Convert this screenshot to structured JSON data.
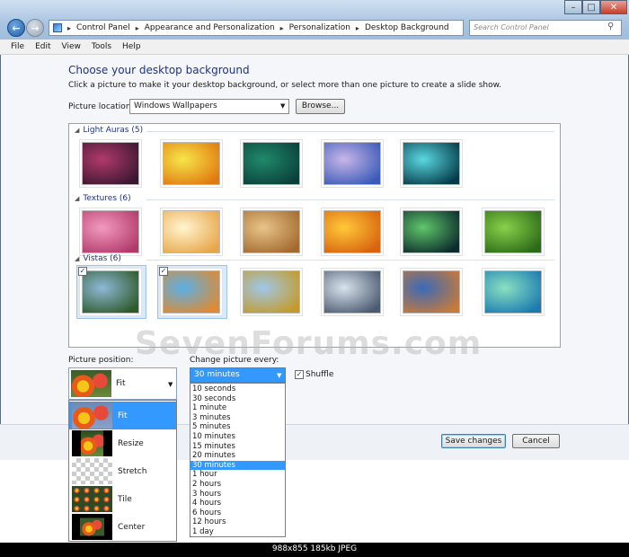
{
  "window": {
    "breadcrumb": [
      "Control Panel",
      "Appearance and Personalization",
      "Personalization",
      "Desktop Background"
    ],
    "search_placeholder": "Search Control Panel"
  },
  "menu": [
    "File",
    "Edit",
    "View",
    "Tools",
    "Help"
  ],
  "page": {
    "title": "Choose your desktop background",
    "instructions": "Click a picture to make it your desktop background, or select more than one picture to create a slide show.",
    "location_label": "Picture location:",
    "location_value": "Windows Wallpapers",
    "browse_label": "Browse..."
  },
  "gallery": {
    "groups": [
      {
        "label": "Light Auras (5)",
        "thumbs": [
          {
            "c1": "#b13a6b",
            "c2": "#3b1731",
            "selected": false
          },
          {
            "c1": "#f7e64a",
            "c2": "#e07a10",
            "selected": false
          },
          {
            "c1": "#1f8a6a",
            "c2": "#0b3f3a",
            "selected": false
          },
          {
            "c1": "#c8b6e8",
            "c2": "#3a5ab8",
            "selected": false
          },
          {
            "c1": "#59d8e0",
            "c2": "#053a48",
            "selected": false
          }
        ]
      },
      {
        "label": "Textures (6)",
        "thumbs": [
          {
            "c1": "#f29ac0",
            "c2": "#b23a6a",
            "selected": false
          },
          {
            "c1": "#fff6d0",
            "c2": "#e8a64a",
            "selected": false
          },
          {
            "c1": "#e8c48a",
            "c2": "#a36a2e",
            "selected": false
          },
          {
            "c1": "#ffc93a",
            "c2": "#d8620e",
            "selected": false
          },
          {
            "c1": "#5fc76a",
            "c2": "#0b2a2c",
            "selected": false
          },
          {
            "c1": "#8ad04a",
            "c2": "#2a6a18",
            "selected": false
          }
        ]
      },
      {
        "label": "Vistas (6)",
        "thumbs": [
          {
            "c1": "#8fb9d8",
            "c2": "#2e5a2a",
            "selected": true
          },
          {
            "c1": "#5ab0e8",
            "c2": "#e08a30",
            "selected": true
          },
          {
            "c1": "#9fc8ea",
            "c2": "#c49a2a",
            "selected": false
          },
          {
            "c1": "#d8e4ee",
            "c2": "#4a5a70",
            "selected": false
          },
          {
            "c1": "#3a6ab8",
            "c2": "#c87a3a",
            "selected": false
          },
          {
            "c1": "#8ae0c0",
            "c2": "#1a7ab0",
            "selected": false
          }
        ]
      }
    ]
  },
  "watermark": "SevenForums.com",
  "position": {
    "label": "Picture position:",
    "value": "Fit",
    "options": [
      "Fit",
      "Resize",
      "Stretch",
      "Tile",
      "Center"
    ]
  },
  "interval": {
    "label": "Change picture every:",
    "value": "30 minutes",
    "options": [
      "10 seconds",
      "30 seconds",
      "1 minute",
      "3 minutes",
      "5 minutes",
      "10 minutes",
      "15 minutes",
      "20 minutes",
      "30 minutes",
      "1 hour",
      "2 hours",
      "3 hours",
      "4 hours",
      "6 hours",
      "12 hours",
      "1 day"
    ]
  },
  "shuffle": {
    "label": "Shuffle",
    "checked": true
  },
  "footer": {
    "save_label": "Save changes",
    "cancel_label": "Cancel"
  },
  "image_info": "988x855  185kb  JPEG"
}
